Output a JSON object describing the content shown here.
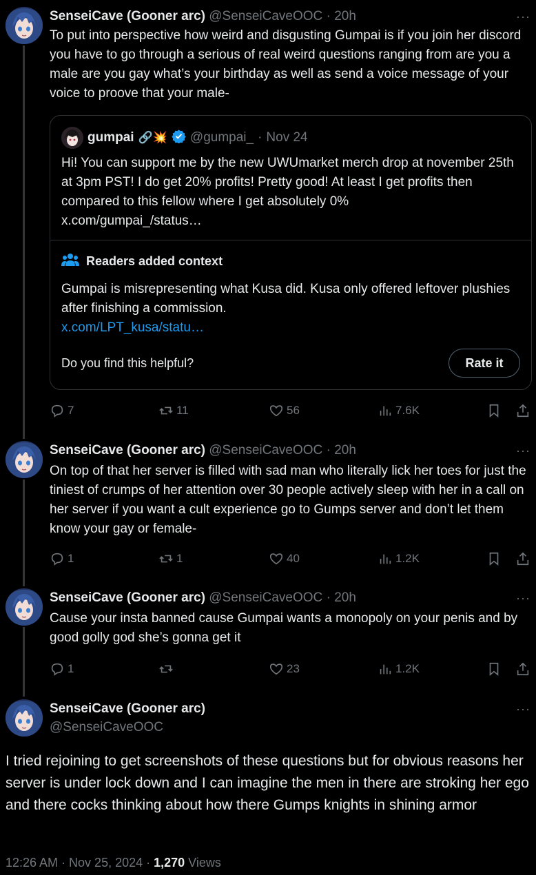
{
  "author": {
    "name": "SenseiCave (Gooner arc)",
    "handle": "@SenseiCaveOOC",
    "time": "20h"
  },
  "tweets": [
    {
      "text": "To put into perspective how weird and disgusting Gumpai is if you join her discord you have to go through a serious of real weird questions ranging from are you a male are you gay what’s your birthday as well as send a voice message of your voice to proove that your male-",
      "replies": "7",
      "retweets": "11",
      "likes": "56",
      "views": "7.6K"
    },
    {
      "text": "On top of that her server is filled with sad man who literally lick her toes for just the tiniest of crumps of her attention over 30 people actively sleep with her in a call on her server if you want a cult experience go to Gumps server and don’t let them know your gay or female-",
      "replies": "1",
      "retweets": "1",
      "likes": "40",
      "views": "1.2K"
    },
    {
      "text": "Cause your insta banned cause Gumpai wants a monopoly on your penis and by good golly god she’s gonna get it",
      "replies": "1",
      "retweets": "",
      "likes": "23",
      "views": "1.2K"
    }
  ],
  "quote": {
    "name": "gumpai",
    "emoji": "🔗💥",
    "handle": "@gumpai_",
    "date": "Nov 24",
    "text": "Hi! You can support me by the new UWUmarket merch drop at november 25th at 3pm PST! I do get 20% profits! Pretty good! At least I get profits then compared to this fellow where I get absolutely 0%",
    "link": "x.com/gumpai_/status…",
    "notes": {
      "title": "Readers added context",
      "text": "Gumpai is misrepresenting what Kusa did. Kusa only offered leftover plushies after finishing a commission.",
      "link": "x.com/LPT_kusa/statu…",
      "question": "Do you find this helpful?",
      "button": "Rate it"
    }
  },
  "main_tweet": {
    "text": "I tried rejoining to get screenshots of these questions but for obvious reasons her server is under lock down and I can imagine the men in there are stroking her ego and there cocks thinking about how there Gumps knights in shining armor",
    "timestamp": "12:26 AM · Nov 25, 2024 · ",
    "views_count": "1,270",
    "views_label": " Views"
  },
  "more_icon": "···",
  "colors": {
    "accent": "#1d9bf0",
    "muted": "#71767b",
    "border": "#2f3336"
  }
}
